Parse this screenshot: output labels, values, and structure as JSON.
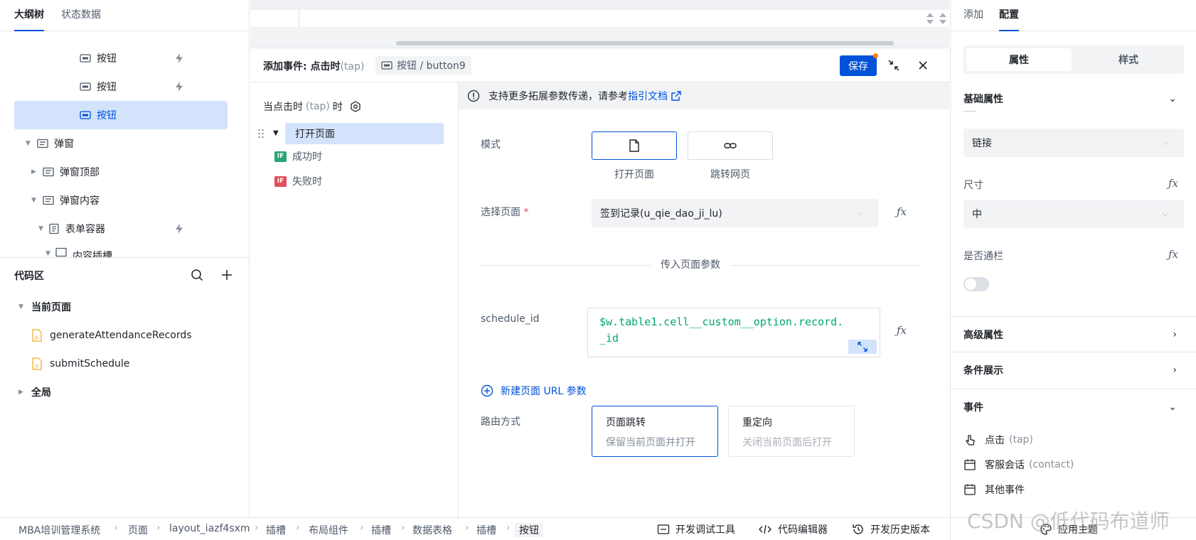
{
  "left_tabs": [
    "大纲树",
    "状态数据"
  ],
  "tree": [
    {
      "label": "按钮",
      "selected": false
    },
    {
      "label": "按钮",
      "selected": false
    },
    {
      "label": "按钮",
      "selected": true
    },
    {
      "label": "弹窗"
    },
    {
      "label": "弹窗顶部"
    },
    {
      "label": "弹窗内容"
    },
    {
      "label": "表单容器"
    },
    {
      "label": "内容插槽"
    }
  ],
  "code_area": {
    "title": "代码区",
    "current_page": "当前页面",
    "files": [
      "generateAttendanceRecords",
      "submitSchedule"
    ],
    "global": "全局"
  },
  "event": {
    "title_prefix": "添加事件: 点击时",
    "title_suffix": "(tap)",
    "target_label": "按钮 / button9",
    "save": "保存",
    "trigger_prefix": "当点击时",
    "trigger_tap": "(tap)",
    "trigger_suffix": "时",
    "action": "打开页面",
    "success": "成功时",
    "fail": "失败时",
    "if_badge": "IF",
    "notice_text": "支持更多拓展参数传递，请参考",
    "notice_link": "指引文档",
    "mode_label": "模式",
    "mode_open": "打开页面",
    "mode_jump": "跳转网页",
    "select_page_label": "选择页面",
    "required_mark": "*",
    "select_page_value": "签到记录(u_qie_dao_ji_lu)",
    "params_divider": "传入页面参数",
    "param_key": "schedule_id",
    "param_value_line1": "$w.table1.cell__custom__option.record.",
    "param_value_line2": "_id",
    "add_param": "新建页面 URL 参数",
    "route_label": "路由方式",
    "route_push": "页面跳转",
    "route_push_desc": "保留当前页面并打开",
    "route_redirect": "重定向",
    "route_redirect_desc": "关闭当前页面后打开",
    "fx": "ƒx"
  },
  "right_panel": {
    "tabs": [
      "添加",
      "配置"
    ],
    "sub_tabs": [
      "属性",
      "样式"
    ],
    "basic": "基础属性",
    "type_value": "链接",
    "size_label": "尺寸",
    "size_value": "中",
    "block_label": "是否通栏",
    "advanced": "高级属性",
    "conditional": "条件展示",
    "events": "事件",
    "event_items": [
      {
        "label": "点击",
        "sub": "(tap)"
      },
      {
        "label": "客服会话",
        "sub": "(contact)"
      },
      {
        "label": "其他事件",
        "sub": ""
      }
    ]
  },
  "breadcrumb": [
    "MBA培训管理系统",
    "页面",
    "layout_iazf4sxm",
    "插槽",
    "布局组件",
    "插槽",
    "数据表格",
    "插槽",
    "按钮"
  ],
  "bottom_tools": [
    "开发调试工具",
    "代码编辑器",
    "开发历史版本",
    "应用主题"
  ],
  "watermark": "CSDN @低代码布道师",
  "colors": {
    "primary": "#0052d9",
    "selected_bg": "#d4e3fc",
    "code_green": "#00a870",
    "if_green": "#2ba471",
    "if_red": "#e34d59"
  }
}
